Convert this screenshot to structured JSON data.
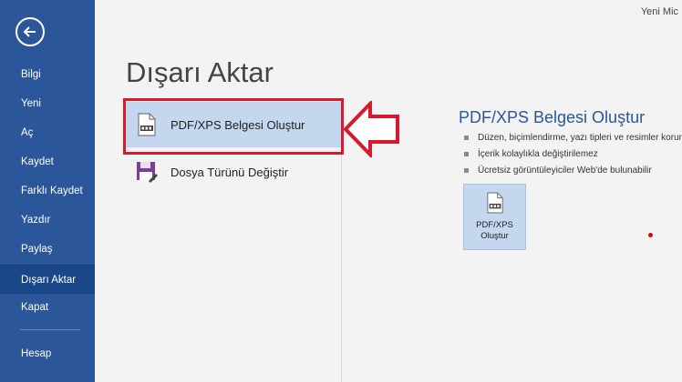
{
  "sidebar": {
    "back_icon": "back-arrow-icon",
    "items": [
      {
        "label": "Bilgi"
      },
      {
        "label": "Yeni"
      },
      {
        "label": "Aç"
      },
      {
        "label": "Kaydet"
      },
      {
        "label": "Farklı Kaydet"
      },
      {
        "label": "Yazdır"
      },
      {
        "label": "Paylaş"
      },
      {
        "label": "Dışarı Aktar",
        "active": true
      },
      {
        "label": "Kapat"
      },
      {
        "label": "Hesap"
      }
    ],
    "colors": {
      "background": "#2b579a",
      "active": "#19478a"
    }
  },
  "header": {
    "user_name": "Yeni Mic"
  },
  "main": {
    "title": "Dışarı Aktar",
    "options": [
      {
        "label": "PDF/XPS Belgesi Oluştur",
        "icon": "pdf-document-icon",
        "selected": true
      },
      {
        "label": "Dosya Türünü Değiştir",
        "icon": "save-disk-icon",
        "selected": false
      }
    ]
  },
  "detail": {
    "title": "PDF/XPS Belgesi Oluştur",
    "bullets": [
      "Düzen, biçimlendirme, yazı tipleri ve resimler korunur",
      "İçerik kolaylıkla değiştirilemez",
      "Ücretsiz görüntüleyiciler Web'de bulunabilir"
    ],
    "button": {
      "line1": "PDF/XPS",
      "line2": "Oluştur",
      "icon": "pdf-document-icon"
    }
  },
  "annotations": {
    "highlight_color": "#d8192c",
    "arrow": "red-arrow-icon"
  }
}
